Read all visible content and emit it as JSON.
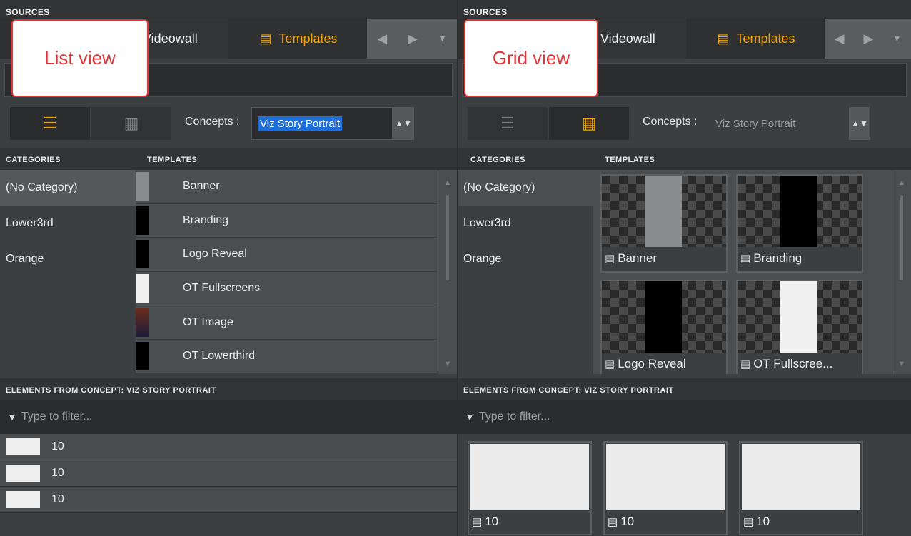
{
  "left": {
    "sources_header": "SOURCES",
    "tabs": {
      "videowall": "Videowall",
      "templates": "Templates"
    },
    "concepts_label": "Concepts :",
    "concepts_value": "Viz Story Portrait",
    "categories_header": "CATEGORIES",
    "templates_header": "TEMPLATES",
    "categories": [
      "(No Category)",
      "Lower3rd",
      "Orange"
    ],
    "templates": [
      "Banner",
      "Branding",
      "Logo Reveal",
      "OT Fullscreens",
      "OT Image",
      "OT Lowerthird"
    ],
    "elements_header": "ELEMENTS FROM CONCEPT: VIZ STORY PORTRAIT",
    "filter_placeholder": "Type to filter...",
    "elements": [
      "10",
      "10",
      "10"
    ],
    "callout": "List view"
  },
  "right": {
    "sources_header": "SOURCES",
    "tabs": {
      "videowall": "Videowall",
      "templates": "Templates"
    },
    "concepts_label": "Concepts :",
    "concepts_value": "Viz Story Portrait",
    "categories_header": "CATEGORIES",
    "templates_header": "TEMPLATES",
    "categories": [
      "(No Category)",
      "Lower3rd",
      "Orange"
    ],
    "templates": [
      "Banner",
      "Branding",
      "Logo Reveal",
      "OT Fullscree..."
    ],
    "elements_header": "ELEMENTS FROM CONCEPT: VIZ STORY PORTRAIT",
    "filter_placeholder": "Type to filter...",
    "elements": [
      "10",
      "10",
      "10"
    ],
    "callout": "Grid view"
  },
  "colors": {
    "accent": "#f0a500",
    "callout": "#e03535",
    "selection": "#1e6fd9"
  },
  "icons": {
    "template": "template-icon",
    "list": "list-view-icon",
    "grid": "grid-view-icon",
    "filter": "filter-icon"
  }
}
